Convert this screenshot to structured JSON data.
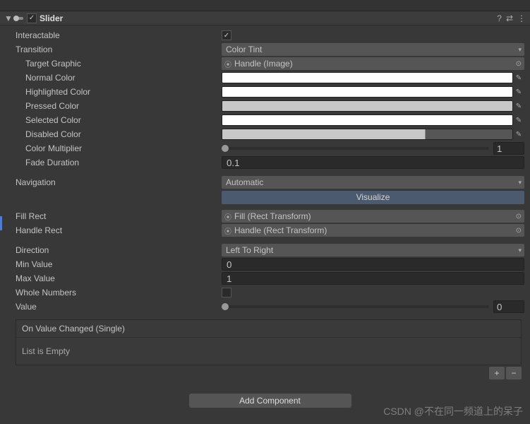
{
  "component": {
    "title": "Slider",
    "enabled": true
  },
  "header_icons": {
    "help": "?",
    "preset": "⇄",
    "menu": "⋮"
  },
  "fields": {
    "interactable": {
      "label": "Interactable",
      "value": true
    },
    "transition": {
      "label": "Transition",
      "value": "Color Tint"
    },
    "targetGraphic": {
      "label": "Target Graphic",
      "value": "Handle (Image)"
    },
    "normalColor": {
      "label": "Normal Color",
      "hex": "#FFFFFF"
    },
    "highlightedColor": {
      "label": "Highlighted Color",
      "hex": "#FFFFFF"
    },
    "pressedColor": {
      "label": "Pressed Color",
      "hex": "#C8C8C8"
    },
    "selectedColor": {
      "label": "Selected Color",
      "hex": "#FFFFFF"
    },
    "disabledColor": {
      "label": "Disabled Color",
      "hex": "#C8C8C880"
    },
    "colorMultiplier": {
      "label": "Color Multiplier",
      "value": "1"
    },
    "fadeDuration": {
      "label": "Fade Duration",
      "value": "0.1"
    },
    "navigation": {
      "label": "Navigation",
      "value": "Automatic"
    },
    "visualize": {
      "label": "Visualize"
    },
    "fillRect": {
      "label": "Fill Rect",
      "value": "Fill (Rect Transform)"
    },
    "handleRect": {
      "label": "Handle Rect",
      "value": "Handle (Rect Transform)"
    },
    "direction": {
      "label": "Direction",
      "value": "Left To Right"
    },
    "minValue": {
      "label": "Min Value",
      "value": "0"
    },
    "maxValue": {
      "label": "Max Value",
      "value": "1"
    },
    "wholeNumbers": {
      "label": "Whole Numbers",
      "value": false
    },
    "value": {
      "label": "Value",
      "value": "0"
    }
  },
  "event": {
    "header": "On Value Changed (Single)",
    "empty": "List is Empty",
    "add": "+",
    "remove": "−"
  },
  "addComponent": "Add Component",
  "watermark": "CSDN @不在同一频道上的呆子"
}
